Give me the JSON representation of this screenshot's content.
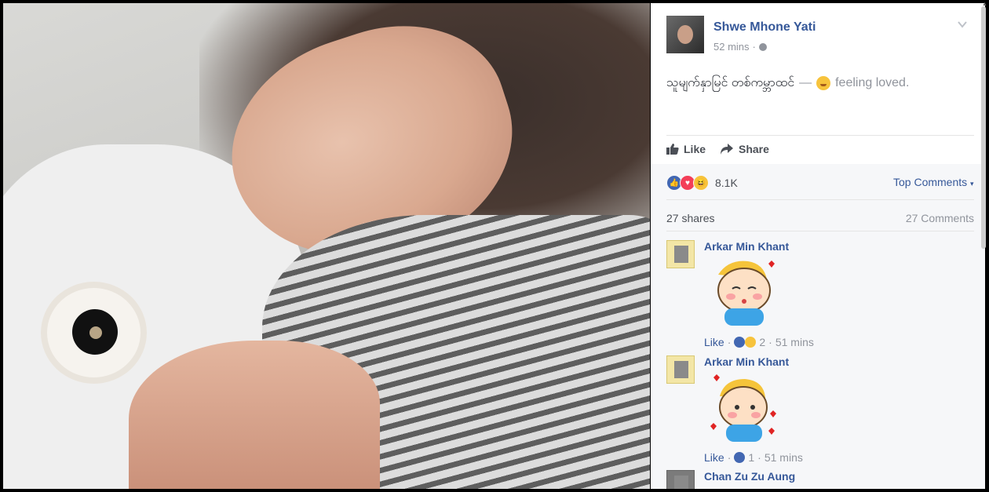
{
  "post": {
    "author": "Shwe Mhone Yati",
    "time": "52 mins",
    "meta_sep": "·",
    "text": "သူမျက်နှာမြင် တစ်ကမ္ဘာထင်",
    "dash": "—",
    "feeling": "feeling loved.",
    "feeling_icon": "smiling-face-icon"
  },
  "actions": {
    "like_label": "Like",
    "share_label": "Share"
  },
  "reactions": {
    "count": "8.1K",
    "types": [
      "like",
      "love",
      "haha"
    ]
  },
  "sort": {
    "label": "Top Comments",
    "caret": "▾"
  },
  "stats": {
    "shares": "27 shares",
    "comments": "27 Comments"
  },
  "comments": [
    {
      "name": "Arkar Min Khant",
      "like_label": "Like",
      "sep": "·",
      "reaction_count": "2",
      "time": "51 mins",
      "reactions": [
        "like",
        "haha"
      ]
    },
    {
      "name": "Arkar Min Khant",
      "like_label": "Like",
      "sep": "·",
      "reaction_count": "1",
      "time": "51 mins",
      "reactions": [
        "like"
      ]
    },
    {
      "name": "Chan Zu Zu Aung"
    }
  ],
  "colors": {
    "link": "#365899",
    "muted": "#90949c",
    "like_blue": "#4267b2",
    "love_red": "#f33e58",
    "haha_yellow": "#f7c33c"
  }
}
